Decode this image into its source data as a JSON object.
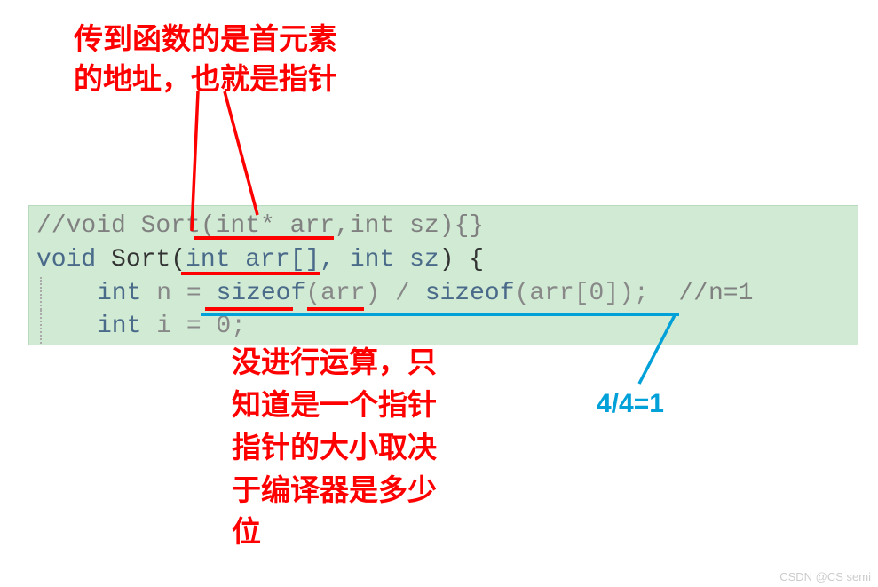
{
  "annotations": {
    "top_line1": "传到函数的是首元素",
    "top_line2": "的地址，也就是指针",
    "mid_line1": "没进行运算，只",
    "mid_line2": "知道是一个指针",
    "mid_line3": "指针的大小取决",
    "mid_line4": "于编译器是多少",
    "mid_line5": "位",
    "right": "4/4=1"
  },
  "code": {
    "line1": "//void Sort(int* arr,int sz){}",
    "line2_pre": "void",
    "line2_func": " Sort(",
    "line2_param": "int arr[], int sz",
    "line2_end": ") {",
    "line3_pre": "int",
    "line3_var": " n = ",
    "line3_sizeof1": "sizeof",
    "line3_mid": "(arr) / ",
    "line3_sizeof2": "sizeof",
    "line3_end": "(arr[0]);  ",
    "line3_comment": "//n=1",
    "line4_pre": "int",
    "line4_end": " i = 0;"
  },
  "watermark": "CSDN @CS semi"
}
